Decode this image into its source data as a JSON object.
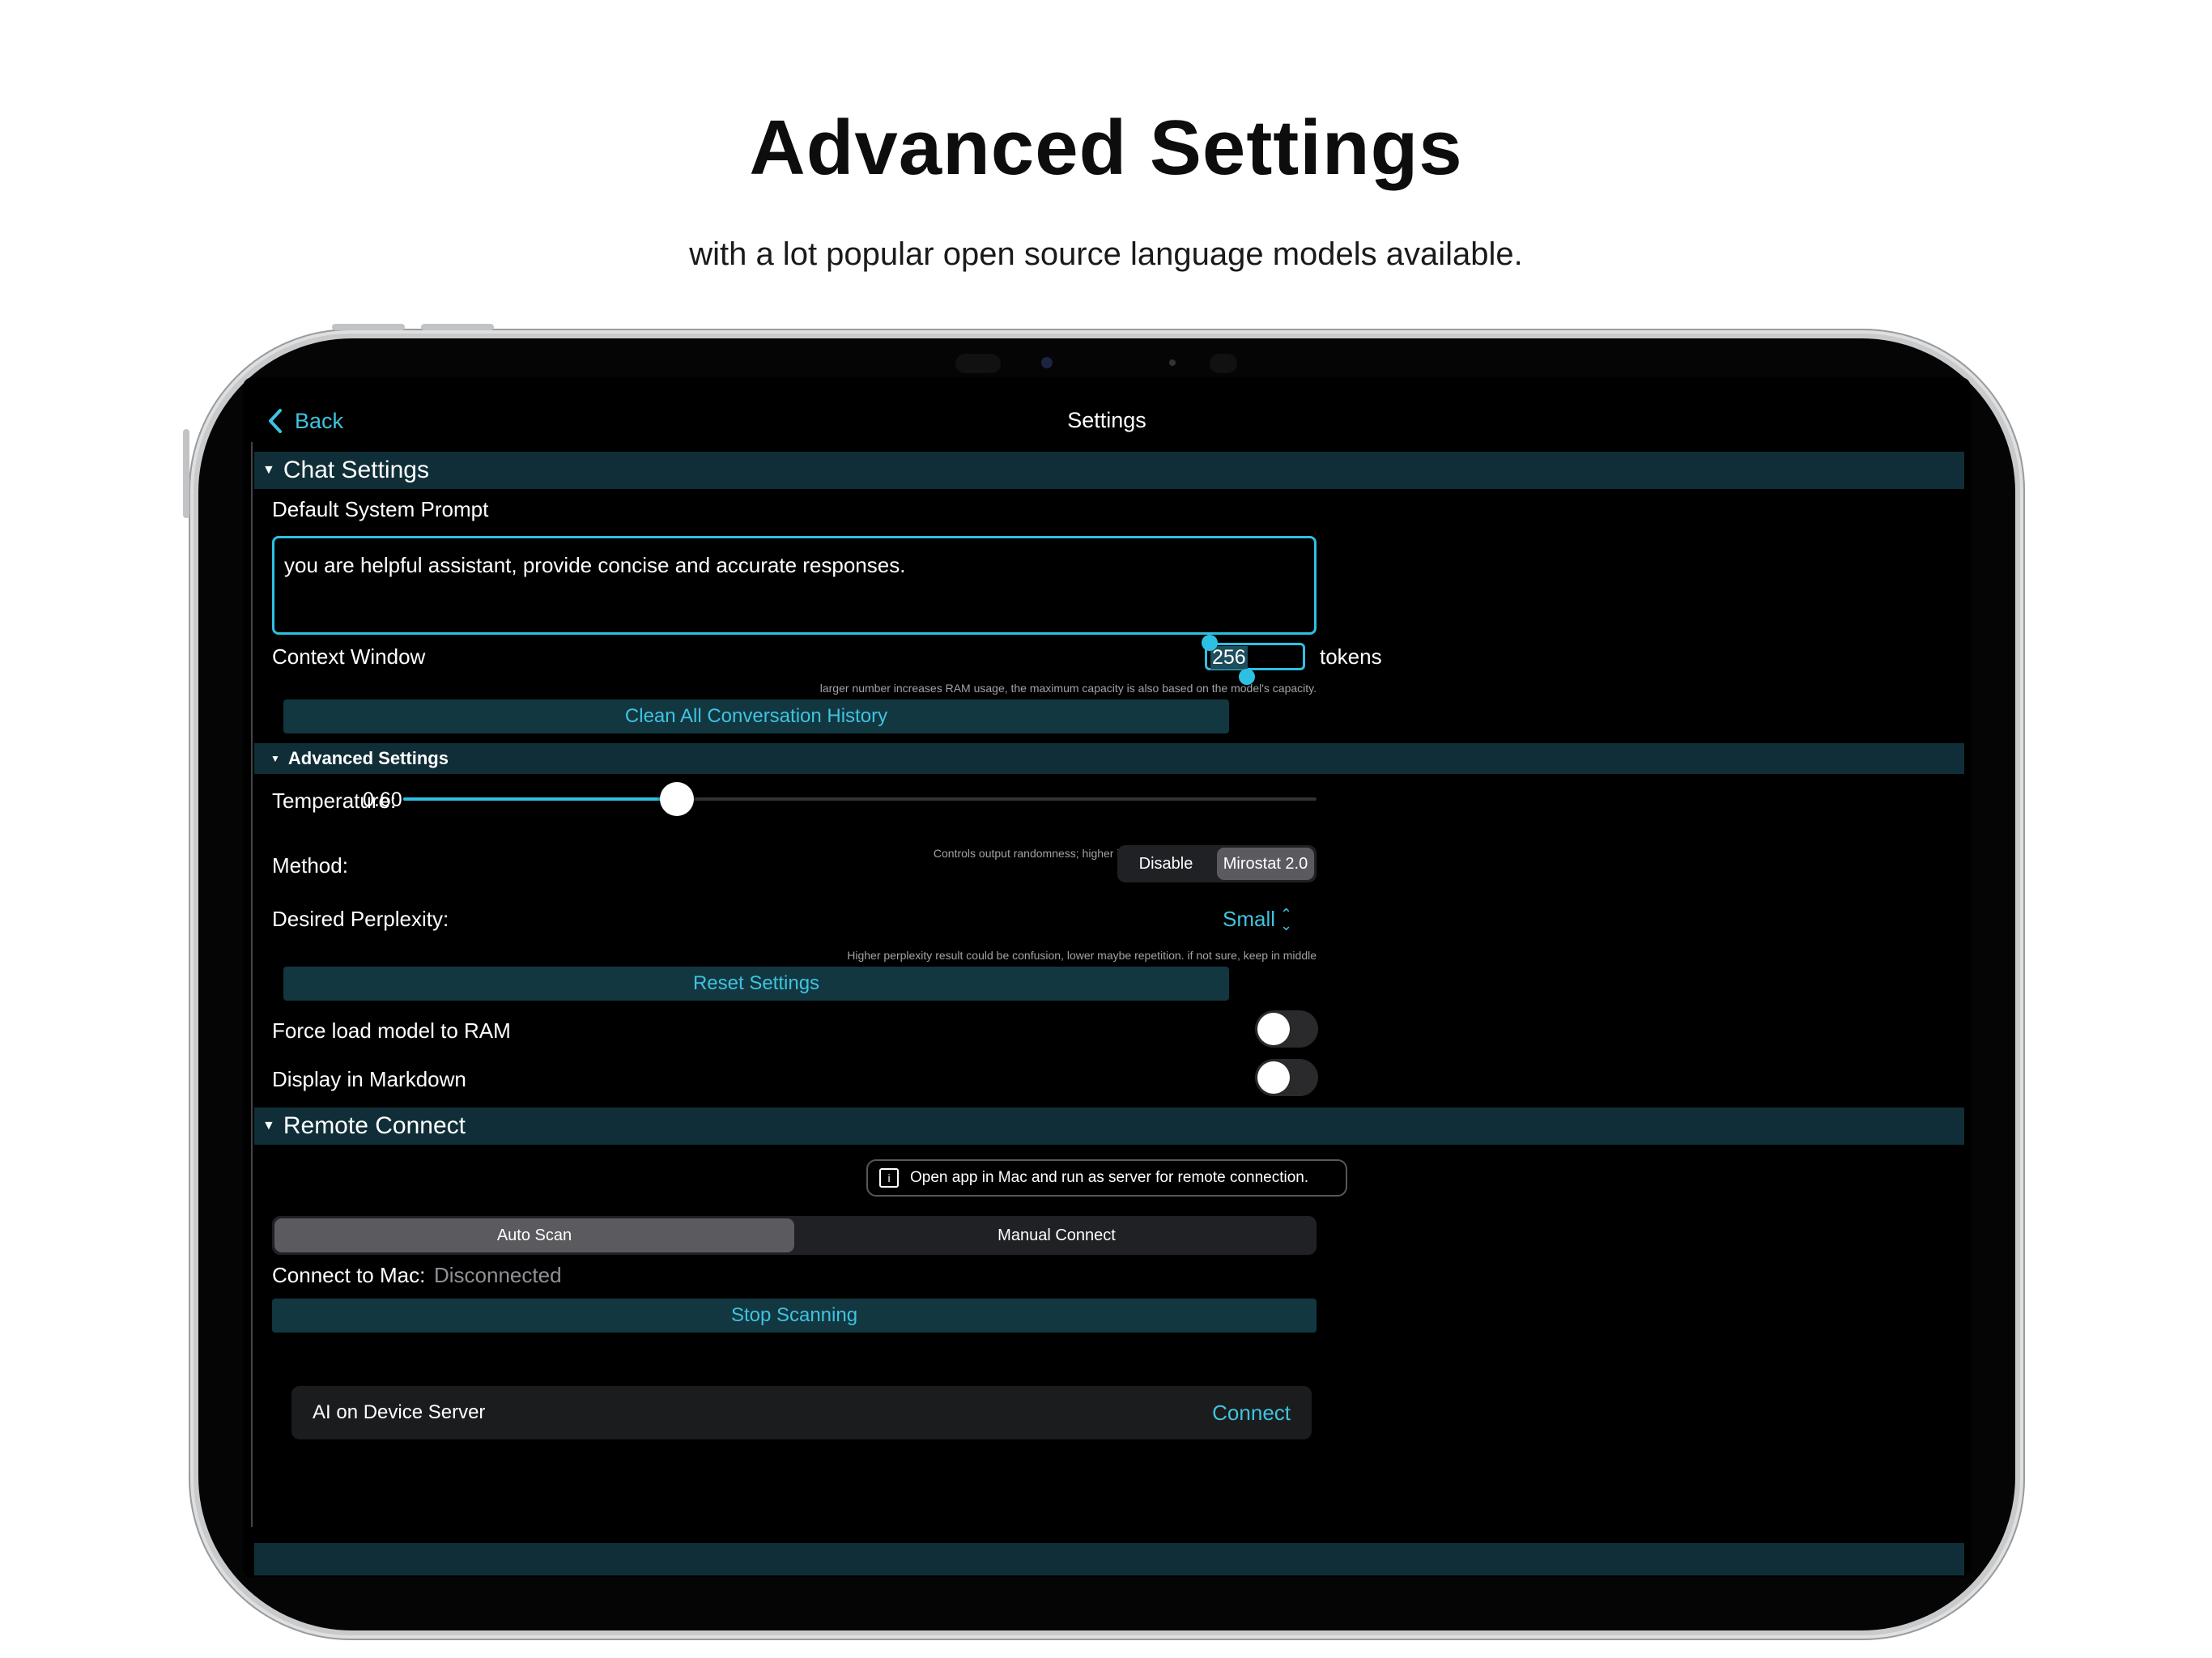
{
  "hero": {
    "title": "Advanced Settings",
    "subtitle": "with a lot popular open source language models available."
  },
  "nav": {
    "back_label": "Back",
    "title": "Settings"
  },
  "chat_settings": {
    "header": "Chat Settings",
    "prompt_label": "Default System Prompt",
    "prompt_value": "you are helpful assistant, provide concise and accurate responses.",
    "context_label": "Context Window",
    "context_value": "256",
    "context_unit": "tokens",
    "context_hint": "larger number increases RAM usage, the maximum capacity is also based on the model's capacity.",
    "clean_button": "Clean All Conversation History"
  },
  "advanced": {
    "header": "Advanced Settings",
    "temperature_label": "Temperature:",
    "temperature_value": "0.60",
    "temperature_fraction": 0.3,
    "temperature_hint": "Controls output randomness; higher is more creative, lower is more focused.",
    "method_label": "Method:",
    "method_options": [
      "Disable",
      "Mirostat 2.0"
    ],
    "method_selected": "Mirostat 2.0",
    "perplexity_label": "Desired Perplexity:",
    "perplexity_value": "Small",
    "perplexity_hint": "Higher perplexity result could be confusion, lower maybe repetition. if not sure, keep in middle",
    "reset_button": "Reset Settings",
    "force_load_label": "Force load model to RAM",
    "force_load_on": false,
    "markdown_label": "Display in Markdown",
    "markdown_on": false
  },
  "remote": {
    "header": "Remote Connect",
    "info": "Open app in Mac and run as server for remote connection.",
    "tabs": [
      "Auto Scan",
      "Manual Connect"
    ],
    "tab_selected": "Auto Scan",
    "connect_label": "Connect to Mac:",
    "connect_status": "Disconnected",
    "stop_button": "Stop Scanning",
    "server_name": "AI on Device Server",
    "server_action": "Connect"
  },
  "colors": {
    "accent": "#2cc0e3",
    "section_bg": "#102e37",
    "button_bg": "#123741",
    "background": "#000000"
  }
}
